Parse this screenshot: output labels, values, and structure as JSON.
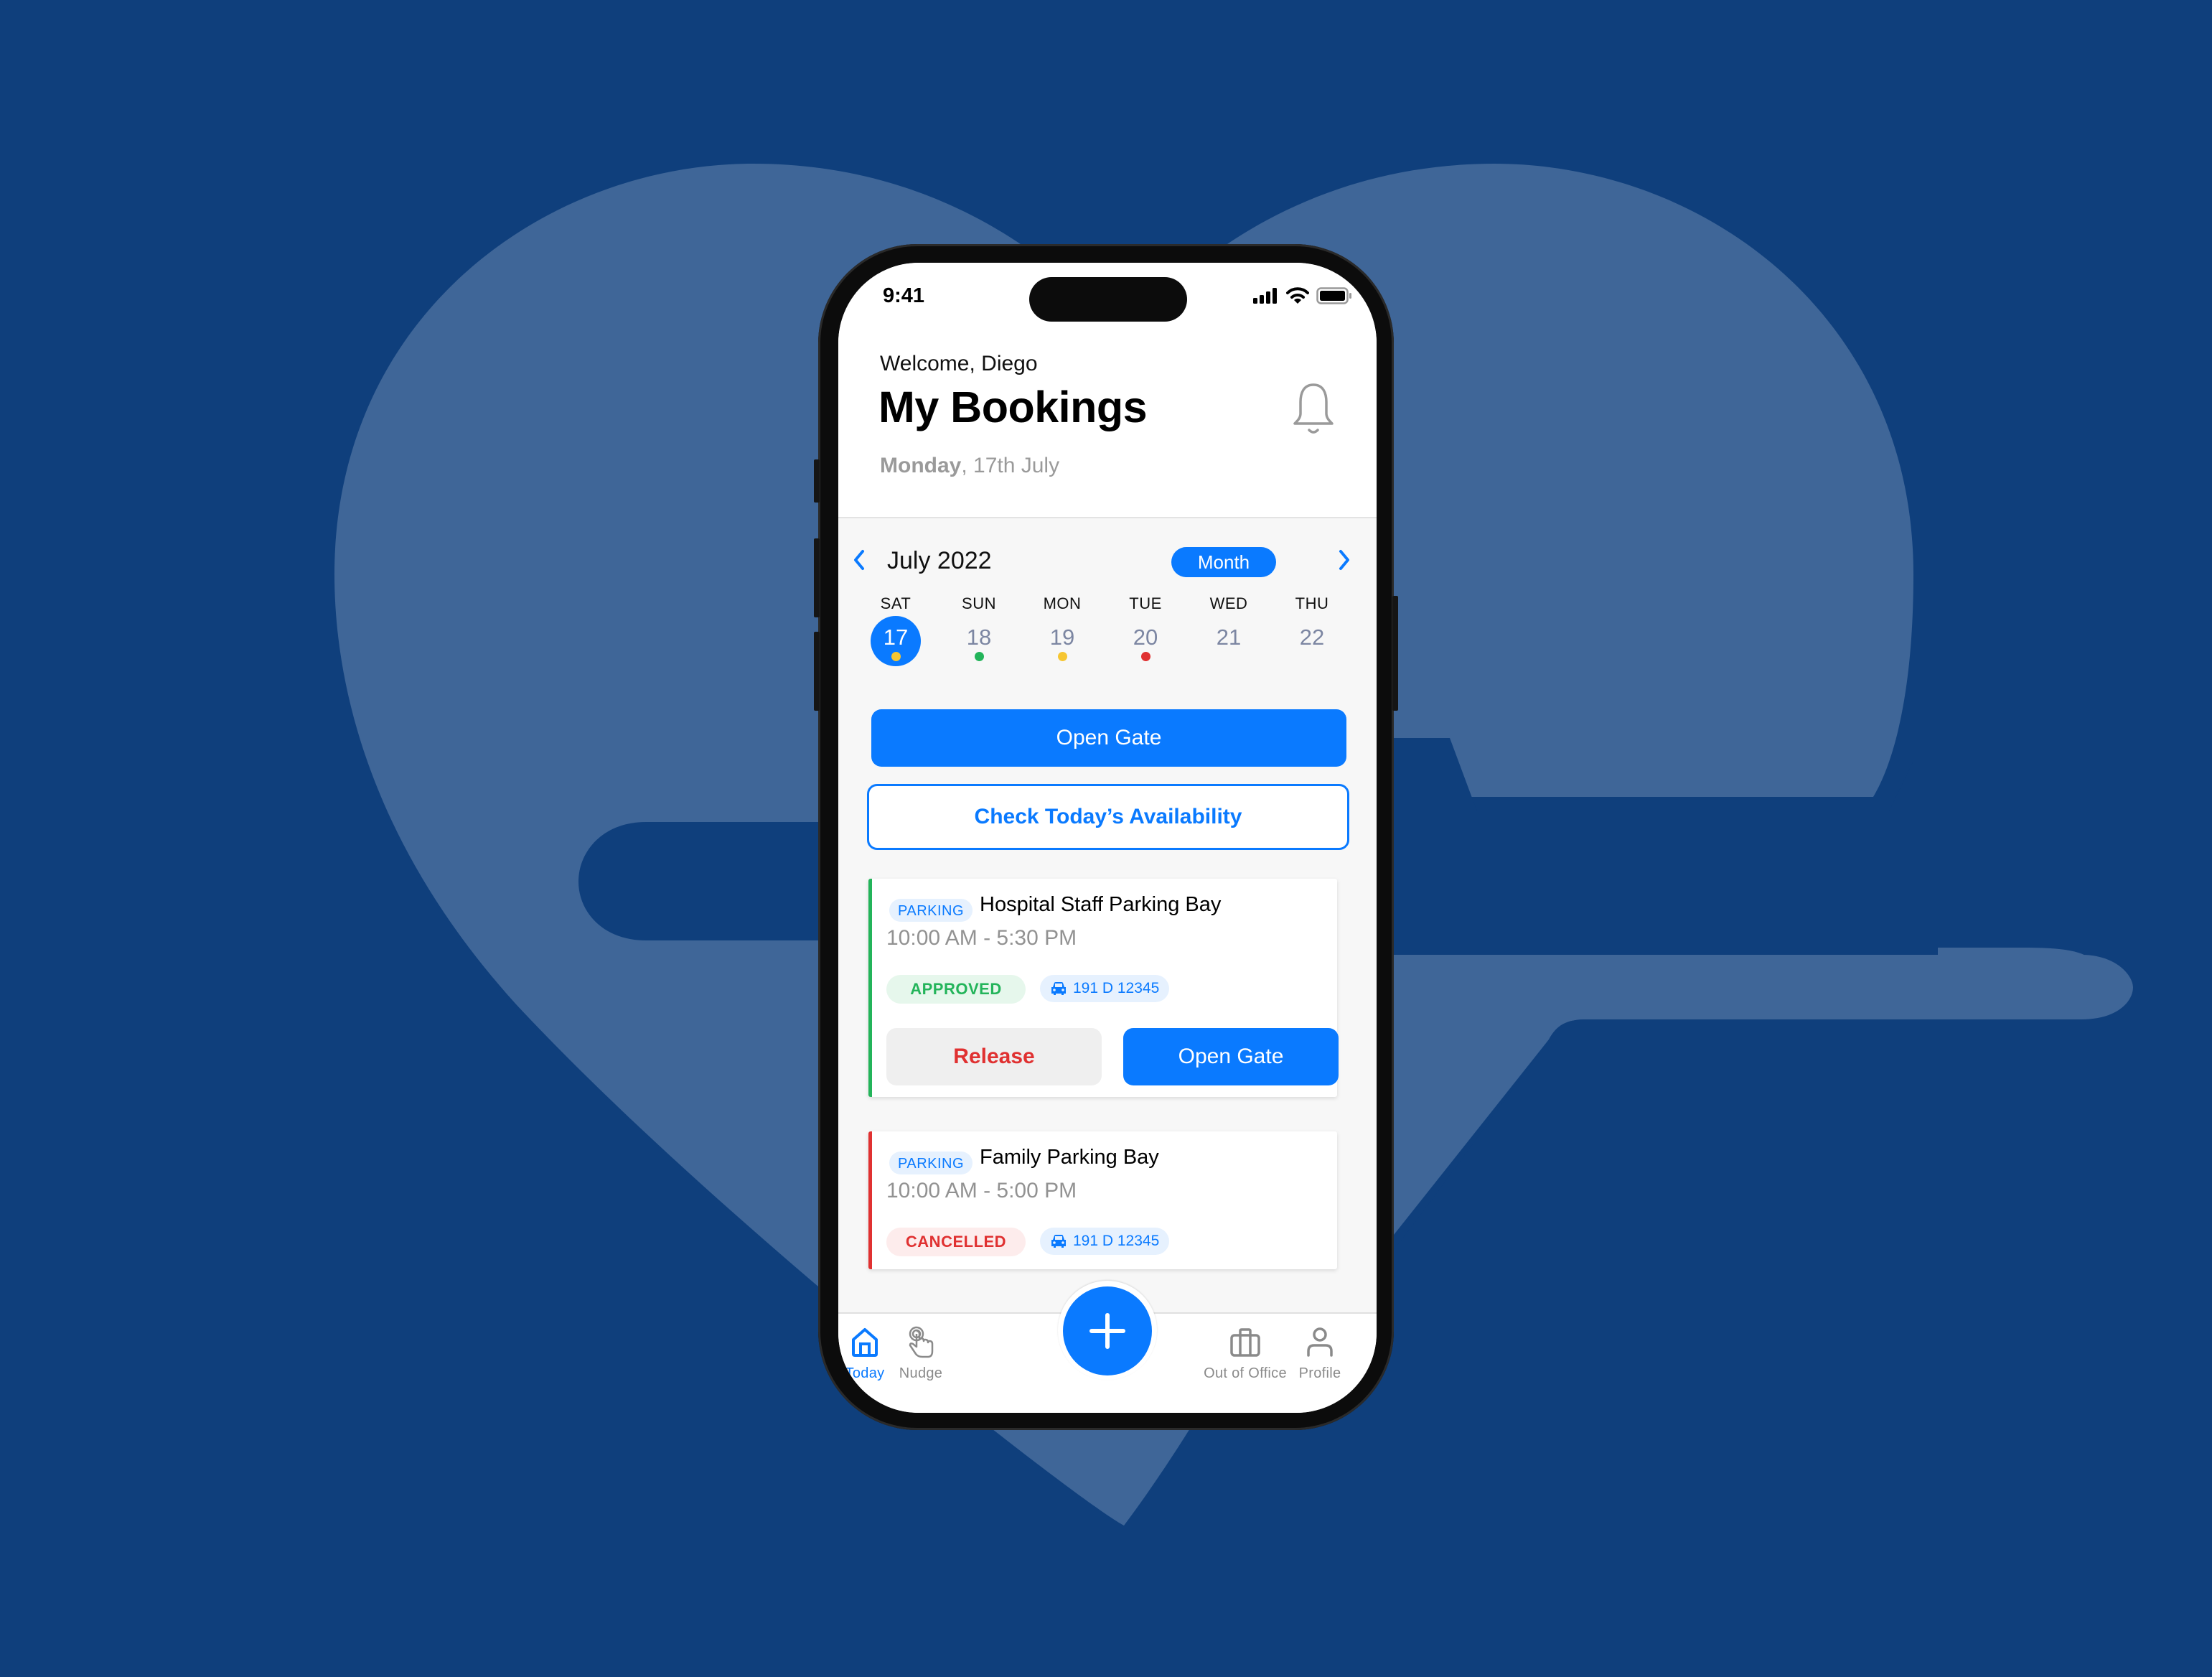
{
  "colors": {
    "background": "#0F3F7C",
    "background_shape": "#3F6698",
    "accent": "#0A7AFF",
    "approved": "#23B45A",
    "cancelled": "#E03131",
    "pending": "#F6C632"
  },
  "status_bar": {
    "time": "9:41",
    "icons": [
      "cellular-signal-icon",
      "wifi-icon",
      "battery-icon"
    ]
  },
  "header": {
    "welcome": "Welcome, Diego",
    "title": "My Bookings",
    "date_weekday": "Monday",
    "date_rest": ", 17th July",
    "notification_icon": "bell-icon"
  },
  "calendar": {
    "month_label": "July 2022",
    "view_toggle": "Month",
    "days": [
      {
        "dow": "SAT",
        "num": "17",
        "selected": true,
        "dot": "pending"
      },
      {
        "dow": "SUN",
        "num": "18",
        "selected": false,
        "dot": "approved"
      },
      {
        "dow": "MON",
        "num": "19",
        "selected": false,
        "dot": "pending"
      },
      {
        "dow": "TUE",
        "num": "20",
        "selected": false,
        "dot": "cancelled"
      },
      {
        "dow": "WED",
        "num": "21",
        "selected": false,
        "dot": null
      },
      {
        "dow": "THU",
        "num": "22",
        "selected": false,
        "dot": null
      }
    ]
  },
  "actions": {
    "open_gate": "Open Gate",
    "check_availability": "Check Today’s Availability"
  },
  "bookings": [
    {
      "tag": "PARKING",
      "name": "Hospital Staff Parking Bay",
      "hours": "10:00 AM - 5:30 PM",
      "status": "APPROVED",
      "plate": "191 D 12345",
      "release_label": "Release",
      "open_gate_label": "Open Gate"
    },
    {
      "tag": "PARKING",
      "name": "Family Parking Bay",
      "hours": "10:00 AM - 5:00 PM",
      "status": "CANCELLED",
      "plate": "191 D 12345"
    }
  ],
  "tabbar": {
    "items": [
      {
        "label": "Today",
        "icon": "home-icon",
        "active": true
      },
      {
        "label": "Nudge",
        "icon": "tap-hand-icon",
        "active": false
      },
      {
        "label": "Out of Office",
        "icon": "briefcase-icon",
        "active": false
      },
      {
        "label": "Profile",
        "icon": "person-icon",
        "active": false
      }
    ],
    "fab_icon": "plus-icon"
  }
}
